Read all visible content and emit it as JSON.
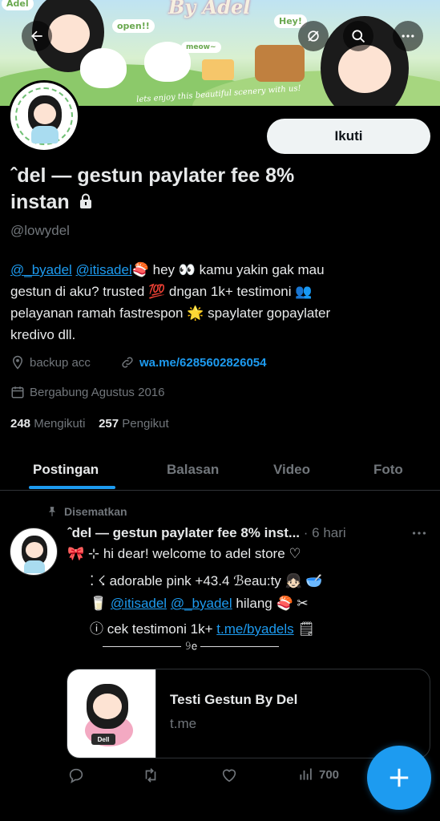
{
  "banner": {
    "title": "By Adel",
    "bubble_left": "Adel",
    "bubble_open": "open!!",
    "bubble_hey": "Hey!",
    "bubble_meow": "meow~",
    "caption": "lets enjoy this beautiful scenery with us!"
  },
  "profile": {
    "follow_label": "Ikuti",
    "display_name": "ˆdel — gestun paylater fee 8% instan",
    "handle": "@lowydel",
    "bio_mentions": [
      "@_byadel",
      "@itisadel"
    ],
    "bio_text_1": "🍣 hey 👀 kamu yakin gak mau",
    "bio_text_2": "gestun di aku? trusted 💯 dngan 1k+ testimoni 👥",
    "bio_text_3": "pelayanan ramah fastrespon 🌟 spaylater gopaylater",
    "bio_text_4": "kredivo dll.",
    "location": "backup acc",
    "website": "wa.me/6285602826054",
    "joined": "Bergabung Agustus 2016",
    "following_count": "248",
    "following_label": "Mengikuti",
    "followers_count": "257",
    "followers_label": "Pengikut"
  },
  "tabs": [
    "Postingan",
    "Balasan",
    "Video",
    "Foto"
  ],
  "post": {
    "pinned_label": "Disematkan",
    "author": "ˆdel — gestun paylater fee 8% inst...",
    "time": "· 6 hari",
    "line1": "🎀 ⊹ hi dear! welcome to adel store ♡",
    "line2": "⁚ ☇ adorable pink +43.4 ℬeau:ty 👧🏻 🥣",
    "line3_pre": "🥛",
    "line3_mention1": "@itisadel",
    "line3_mention2": "@_byadel",
    "line3_post": "hilang 🍣 ✂",
    "line4_pre": "ⓘ cek testimoni 1k+",
    "line4_link": "t.me/byadels",
    "line4_post": "🗒",
    "divider": "——————— 𝟿𝖾 ———————",
    "card_title": "Testi Gestun By Del",
    "card_domain": "t.me",
    "card_tag": "Dell",
    "views": "700"
  },
  "icons": {
    "back": "back-arrow-icon",
    "hide": "eye-off-icon",
    "search": "search-icon",
    "more": "more-icon",
    "lock": "lock-icon",
    "location": "location-pin-icon",
    "link": "link-icon",
    "calendar": "calendar-icon",
    "pin": "pin-icon",
    "reply": "reply-icon",
    "retweet": "retweet-icon",
    "like": "heart-icon",
    "views": "views-icon",
    "compose": "plus-icon"
  },
  "colors": {
    "accent": "#1d9bf0",
    "background": "#000000",
    "text": "#e7e9ea",
    "muted": "#71767b"
  }
}
